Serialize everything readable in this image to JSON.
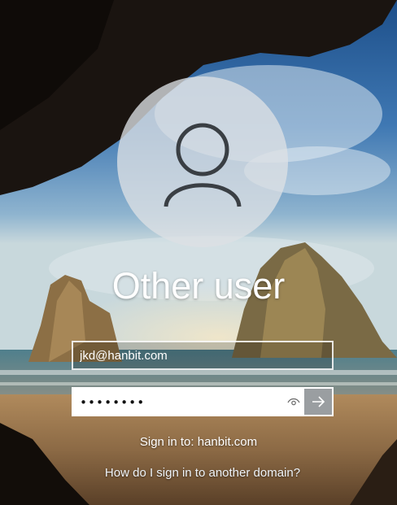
{
  "user_tile": {
    "display_name": "Other user",
    "avatar_icon": "user-silhouette-icon"
  },
  "form": {
    "username_value": "jkd@hanbit.com",
    "password_masked": "••••••••",
    "reveal_icon": "eye-icon",
    "submit_icon": "arrow-right-icon"
  },
  "sign_in_to": "Sign in to: hanbit.com",
  "other_domain_link": "How do I sign in to another domain?"
}
